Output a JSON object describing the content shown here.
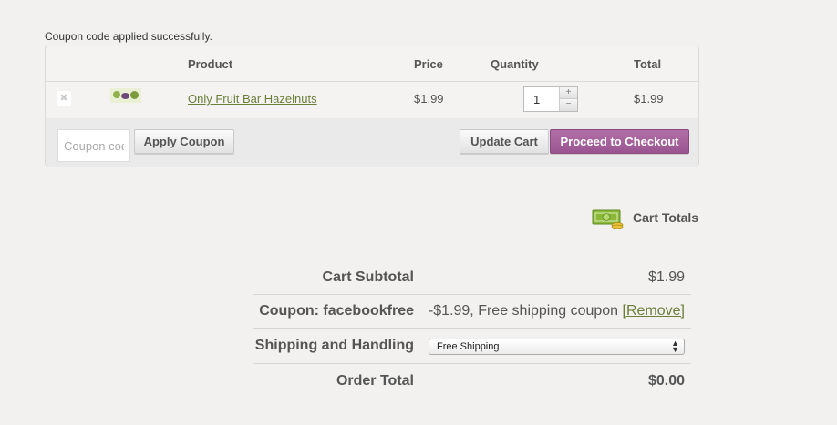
{
  "notice": "Coupon code applied successfully.",
  "cart": {
    "headers": {
      "product": "Product",
      "price": "Price",
      "quantity": "Quantity",
      "total": "Total"
    },
    "items": [
      {
        "remove_icon": "remove-x-icon",
        "name": "Only Fruit Bar Hazelnuts",
        "price": "$1.99",
        "quantity": "1",
        "total": "$1.99"
      }
    ],
    "qty_plus": "+",
    "qty_minus": "−",
    "remove_glyph": "✖",
    "coupon_placeholder": "Coupon code",
    "apply_coupon_label": "Apply Coupon",
    "update_cart_label": "Update Cart",
    "checkout_label": "Proceed to Checkout"
  },
  "totals": {
    "title": "Cart Totals",
    "icon": "money-icon",
    "subtotal_label": "Cart Subtotal",
    "subtotal_value": "$1.99",
    "coupon_label": "Coupon: facebookfree",
    "coupon_value": "-$1.99, Free shipping coupon",
    "coupon_remove": "[Remove]",
    "shipping_label": "Shipping and Handling",
    "shipping_selected": "Free Shipping",
    "order_total_label": "Order Total",
    "order_total_value": "$0.00"
  },
  "colors": {
    "background": "#f2f1f0",
    "link": "#6b7f3a",
    "checkout_button": "#a55f99"
  }
}
